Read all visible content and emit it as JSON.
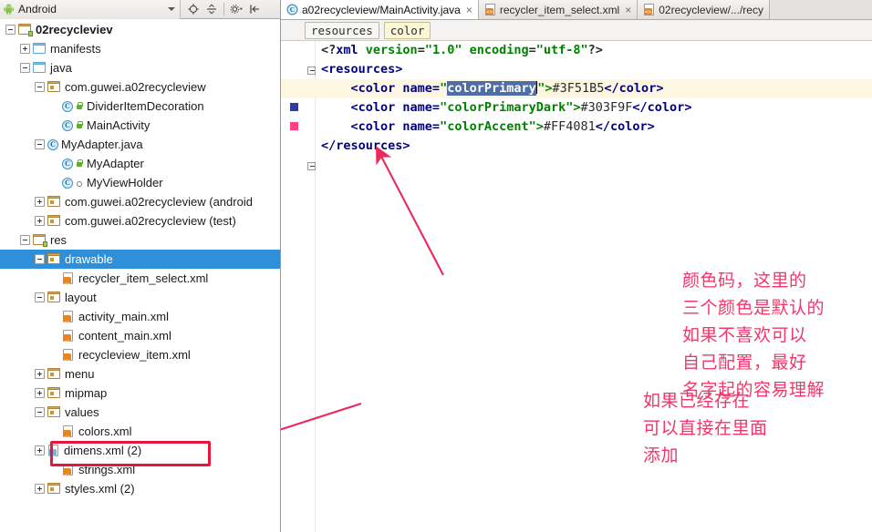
{
  "toolbar": {
    "combo_label": "Android",
    "combo_icon": "android-robot-icon",
    "buttons": [
      {
        "name": "locate-target-icon",
        "label": ""
      },
      {
        "name": "collapse-all-icon",
        "label": ""
      },
      {
        "name": "settings-gear-icon",
        "label": ""
      },
      {
        "name": "hide-panel-icon",
        "label": ""
      }
    ]
  },
  "tree": [
    {
      "indent": 0,
      "toggle": "minus",
      "icon": "folder-module-icon",
      "label": "02recycleviev",
      "bold": true,
      "selected": false
    },
    {
      "indent": 1,
      "toggle": "plus",
      "icon": "folder-blue-icon",
      "label": "manifests",
      "bold": false,
      "selected": false
    },
    {
      "indent": 1,
      "toggle": "minus",
      "icon": "folder-blue-icon",
      "label": "java",
      "bold": false,
      "selected": false
    },
    {
      "indent": 2,
      "toggle": "minus",
      "icon": "folder-package-icon",
      "label": "com.guwei.a02recycleview",
      "bold": false,
      "selected": false
    },
    {
      "indent": 3,
      "toggle": "none",
      "icon": "java-class-icon",
      "label": "DividerItemDecoration",
      "bold": false,
      "selected": false,
      "badge": "lock"
    },
    {
      "indent": 3,
      "toggle": "none",
      "icon": "java-class-icon",
      "label": "MainActivity",
      "bold": false,
      "selected": false,
      "badge": "lock"
    },
    {
      "indent": 2,
      "toggle": "minus",
      "icon": "java-class-icon",
      "label": "MyAdapter.java",
      "bold": false,
      "selected": false
    },
    {
      "indent": 3,
      "toggle": "none",
      "icon": "java-class-icon",
      "label": "MyAdapter",
      "bold": false,
      "selected": false,
      "badge": "lock"
    },
    {
      "indent": 3,
      "toggle": "none",
      "icon": "java-class-icon",
      "label": "MyViewHolder",
      "bold": false,
      "selected": false,
      "badge": "circle"
    },
    {
      "indent": 2,
      "toggle": "plus",
      "icon": "folder-package-icon",
      "label": "com.guwei.a02recycleview (android",
      "bold": false,
      "selected": false
    },
    {
      "indent": 2,
      "toggle": "plus",
      "icon": "folder-package-icon",
      "label": "com.guwei.a02recycleview (test)",
      "bold": false,
      "selected": false
    },
    {
      "indent": 1,
      "toggle": "minus",
      "icon": "folder-module-icon",
      "label": "res",
      "bold": false,
      "selected": false
    },
    {
      "indent": 2,
      "toggle": "minus",
      "icon": "folder-res-icon",
      "label": "drawable",
      "bold": false,
      "selected": true
    },
    {
      "indent": 3,
      "toggle": "none",
      "icon": "xml-file-icon",
      "label": "recycler_item_select.xml",
      "bold": false,
      "selected": false
    },
    {
      "indent": 2,
      "toggle": "minus",
      "icon": "folder-res-icon",
      "label": "layout",
      "bold": false,
      "selected": false
    },
    {
      "indent": 3,
      "toggle": "none",
      "icon": "xml-file-icon",
      "label": "activity_main.xml",
      "bold": false,
      "selected": false
    },
    {
      "indent": 3,
      "toggle": "none",
      "icon": "xml-file-icon",
      "label": "content_main.xml",
      "bold": false,
      "selected": false
    },
    {
      "indent": 3,
      "toggle": "none",
      "icon": "xml-file-icon",
      "label": "recycleview_item.xml",
      "bold": false,
      "selected": false
    },
    {
      "indent": 2,
      "toggle": "plus",
      "icon": "folder-res-icon",
      "label": "menu",
      "bold": false,
      "selected": false
    },
    {
      "indent": 2,
      "toggle": "plus",
      "icon": "folder-res-icon",
      "label": "mipmap",
      "bold": false,
      "selected": false
    },
    {
      "indent": 2,
      "toggle": "minus",
      "icon": "folder-res-icon",
      "label": "values",
      "bold": false,
      "selected": false
    },
    {
      "indent": 3,
      "toggle": "none",
      "icon": "xml-file-icon",
      "label": "colors.xml",
      "bold": false,
      "selected": false
    },
    {
      "indent": 2,
      "toggle": "plus",
      "icon": "xml-file-blue-icon",
      "label": "dimens.xml (2)",
      "bold": false,
      "selected": false
    },
    {
      "indent": 3,
      "toggle": "none",
      "icon": "xml-file-icon",
      "label": "strings.xml",
      "bold": false,
      "selected": false
    },
    {
      "indent": 2,
      "toggle": "plus",
      "icon": "folder-res-icon",
      "label": "styles.xml (2)",
      "bold": false,
      "selected": false
    }
  ],
  "tabs": [
    {
      "label": "a02recycleview/MainActivity.java",
      "icon": "java-class-icon",
      "active": true,
      "close": "×"
    },
    {
      "label": "recycler_item_select.xml",
      "icon": "xml-file-icon",
      "active": false,
      "close": "×"
    },
    {
      "label": "02recycleview/.../recy",
      "icon": "xml-file-icon",
      "active": false,
      "close": ""
    }
  ],
  "breadcrumb": {
    "crumbs": [
      {
        "label": "resources",
        "highlight": false
      },
      {
        "label": "color",
        "highlight": true
      }
    ]
  },
  "code": {
    "line1": {
      "open": "<?",
      "pi": "xml",
      "attr1": " version",
      "eq1": "=",
      "val1": "\"1.0\"",
      "attr2": " encoding",
      "eq2": "=",
      "val2": "\"utf-8\"",
      "close": "?>"
    },
    "line2_open": "<resources>",
    "line6_close": "</resources>",
    "colors": [
      {
        "tag_open": "<color name=",
        "quote": "\"",
        "name": "colorPrimary",
        "quote2": "\">",
        "value": "#3F51B5",
        "tag_close": "</color>",
        "swatch": "#3F51B5",
        "selected": true
      },
      {
        "tag_open": "<color name=",
        "quote": "\"",
        "name": "colorPrimaryDark",
        "quote2": "\">",
        "value": "#303F9F",
        "tag_close": "</color>",
        "swatch": "#2F3D9E",
        "selected": false
      },
      {
        "tag_open": "<color name=",
        "quote": "\"",
        "name": "colorAccent",
        "quote2": "\">",
        "value": "#FF4081",
        "tag_close": "</color>",
        "swatch": "#FF4081",
        "selected": false
      }
    ],
    "gutter_hint_icon": "lightbulb-intention-icon"
  },
  "annotations": {
    "left": "如果已经存在\n可以直接在里面\n添加",
    "right": "颜色码，这里的\n三个颜色是默认的\n如果不喜欢可以\n自己配置，最好\n名字起的容易理解",
    "color": "#F0366B",
    "highlight_box_color": "#E8153F",
    "left_arrow": "arrow-pointing-to-colors-xml",
    "right_arrow": "arrow-pointing-to-color-values"
  }
}
